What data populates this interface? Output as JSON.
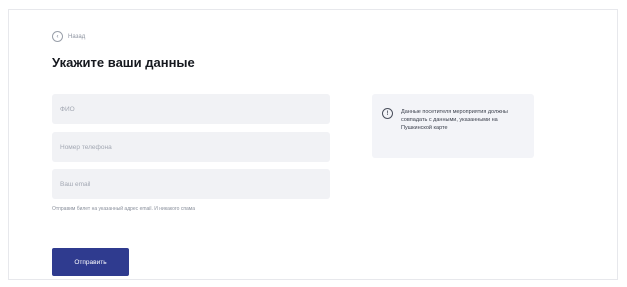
{
  "back": {
    "icon": "chevron-left-icon",
    "label": "Назад"
  },
  "form": {
    "title": "Укажите ваши данные",
    "fields": [
      {
        "placeholder": "ФИО",
        "value": ""
      },
      {
        "placeholder": "Номер телефона",
        "value": ""
      },
      {
        "placeholder": "Ваш email",
        "value": ""
      }
    ],
    "hint": "Отправим билет на указанный адрес email. И никакого спама",
    "submit_label": "Отправить"
  },
  "notice": {
    "icon": "info-icon",
    "text": "Данные посетителя мероприятия должны совпадать с данными, указанными на Пушкинской карте"
  },
  "colors": {
    "accent": "#2f3b8f",
    "field_background": "#f1f2f5",
    "notice_background": "#f3f4f8"
  }
}
